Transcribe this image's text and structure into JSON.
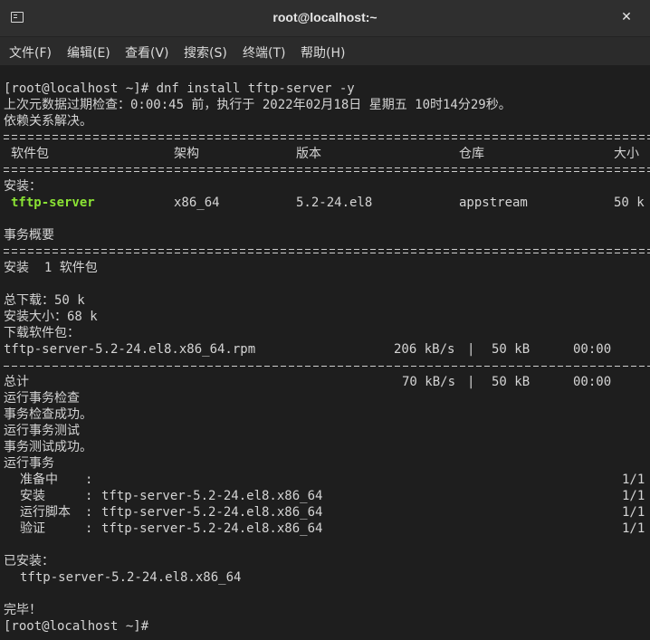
{
  "window": {
    "title": "root@localhost:~"
  },
  "menu": {
    "items": [
      "文件(F)",
      "编辑(E)",
      "查看(V)",
      "搜索(S)",
      "终端(T)",
      "帮助(H)"
    ]
  },
  "terminal": {
    "command_line": "[root@localhost ~]# dnf install tftp-server -y",
    "metadata_line": "上次元数据过期检查：0:00:45 前，执行于 2022年02月18日 星期五 10时14分29秒。",
    "resolved_line": "依赖关系解决。",
    "table": {
      "headers": {
        "package": "软件包",
        "arch": "架构",
        "version": "版本",
        "repo": "仓库",
        "size": "大小"
      },
      "section_label": "安装：",
      "row": {
        "package": "tftp-server",
        "arch": "x86_64",
        "version": "5.2-24.el8",
        "repo": "appstream",
        "size": "50 k"
      }
    },
    "summary_title": "事务概要",
    "install_count_line": "安装  1 软件包",
    "download_total_line": "总下载：50 k",
    "install_size_line": "安装大小：68 k",
    "downloading_label": "下载软件包：",
    "download_row": {
      "file": "tftp-server-5.2-24.el8.x86_64.rpm",
      "rate": "206 kB/s",
      "size": "50 kB",
      "time": "00:00"
    },
    "total_row": {
      "label": "总计",
      "rate": "70 kB/s",
      "size": "50 kB",
      "time": "00:00"
    },
    "bar_separator": "|",
    "transaction_lines": [
      "运行事务检查",
      "事务检查成功。",
      "运行事务测试",
      "事务测试成功。",
      "运行事务"
    ],
    "steps": [
      {
        "label": "准备中",
        "target": "",
        "progress": "1/1"
      },
      {
        "label": "安装",
        "target": "tftp-server-5.2-24.el8.x86_64",
        "progress": "1/1"
      },
      {
        "label": "运行脚本",
        "target": "tftp-server-5.2-24.el8.x86_64",
        "progress": "1/1"
      },
      {
        "label": "验证",
        "target": "tftp-server-5.2-24.el8.x86_64",
        "progress": "1/1"
      }
    ],
    "step_separator": ":",
    "installed_label": "已安装：",
    "installed_item": "tftp-server-5.2-24.el8.x86_64",
    "done_line": "完毕！",
    "prompt": "[root@localhost ~]#"
  },
  "colors": {
    "terminal_background": "#1e1e1e",
    "text": "#d4d4d4",
    "package_highlight": "#8ae234",
    "chrome": "#2d2d2d"
  }
}
